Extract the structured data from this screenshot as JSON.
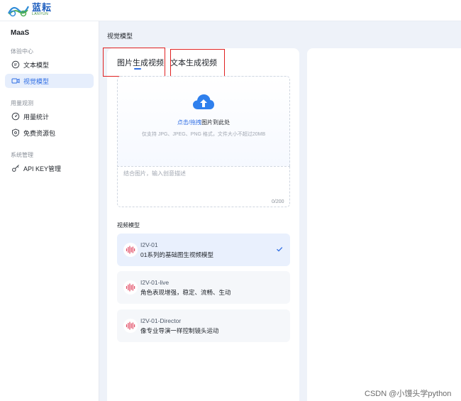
{
  "app": {
    "logo_name": "蓝耘",
    "logo_sub": "LANYUN"
  },
  "sidebar": {
    "brand": "MaaS",
    "groups": [
      {
        "title": "体验中心",
        "items": [
          {
            "label": "文本模型",
            "icon": "chat-icon",
            "active": false
          },
          {
            "label": "视觉模型",
            "icon": "video-icon",
            "active": true
          }
        ]
      },
      {
        "title": "用量观测",
        "items": [
          {
            "label": "用量统计",
            "icon": "gauge-icon",
            "active": false
          },
          {
            "label": "免费资源包",
            "icon": "shield-icon",
            "active": false
          }
        ]
      },
      {
        "title": "系统管理",
        "items": [
          {
            "label": "API KEY管理",
            "icon": "key-icon",
            "active": false
          }
        ]
      }
    ]
  },
  "page": {
    "title": "视觉模型"
  },
  "tabs": [
    {
      "label": "图片生成视频",
      "active": true
    },
    {
      "label": "文本生成视频",
      "active": false
    }
  ],
  "upload": {
    "link_text": "点击/拖拽",
    "main_text": "图片到此处",
    "hint": "仅支持 JPG、JPEG、PNG 格式，文件大小不超过20MB"
  },
  "prompt": {
    "placeholder": "结合图片，输入创意描述",
    "counter": "0/200"
  },
  "models": {
    "section_label": "视频模型",
    "items": [
      {
        "name": "I2V-01",
        "desc": "01系列的基础图生视频模型",
        "selected": true
      },
      {
        "name": "I2V-01-live",
        "desc": "角色表现增强，稳定、流畅、生动",
        "selected": false
      },
      {
        "name": "I2V-01-Director",
        "desc": "像专业导演一样控制镜头运动",
        "selected": false
      }
    ]
  },
  "colors": {
    "accent": "#2f6ee4",
    "annotation": "#e02020",
    "model_icon": "#e0455f"
  },
  "watermark": "CSDN @小馒头学python"
}
